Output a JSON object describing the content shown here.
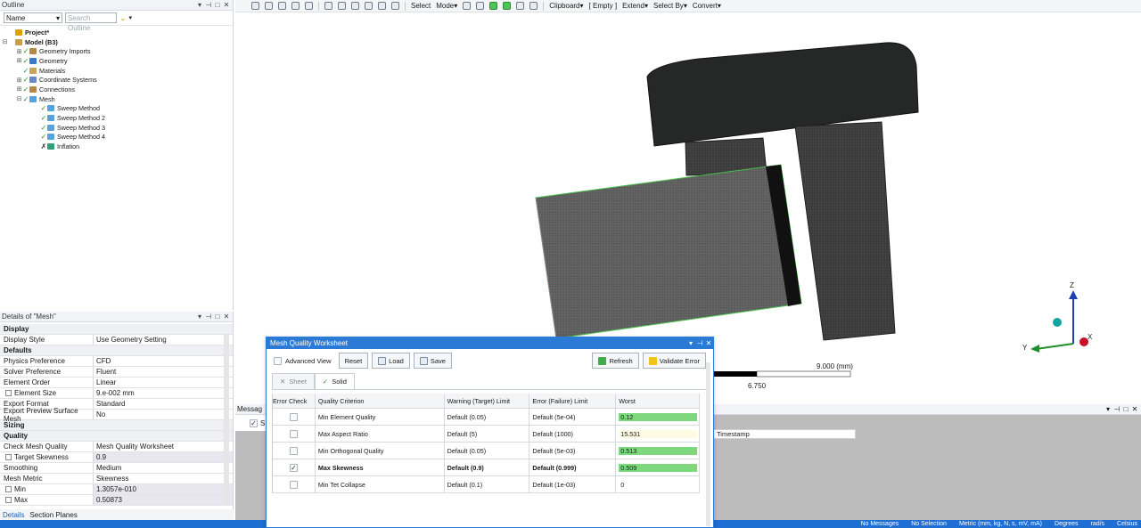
{
  "outline": {
    "title": "Outline",
    "controls": [
      "▾",
      "⊣",
      "□",
      "✕"
    ],
    "name_select": "Name",
    "search_placeholder": "Search Outline",
    "tree": [
      {
        "label": "Project*",
        "bold": true,
        "level": 0
      },
      {
        "label": "Model (B3)",
        "bold": true,
        "level": 1
      },
      {
        "label": "Geometry Imports",
        "level": 2
      },
      {
        "label": "Geometry",
        "level": 2
      },
      {
        "label": "Materials",
        "level": 2
      },
      {
        "label": "Coordinate Systems",
        "level": 2
      },
      {
        "label": "Connections",
        "level": 2
      },
      {
        "label": "Mesh",
        "level": 2
      },
      {
        "label": "Sweep Method",
        "level": 3
      },
      {
        "label": "Sweep Method 2",
        "level": 3
      },
      {
        "label": "Sweep Method 3",
        "level": 3
      },
      {
        "label": "Sweep Method 4",
        "level": 3
      },
      {
        "label": "Inflation",
        "level": 3
      }
    ]
  },
  "details": {
    "title": "Details of \"Mesh\"",
    "rows": [
      {
        "k": "Display",
        "v": "",
        "section": true
      },
      {
        "k": "Display Style",
        "v": "Use Geometry Setting"
      },
      {
        "k": "Defaults",
        "v": "",
        "section": true
      },
      {
        "k": "Physics Preference",
        "v": "CFD"
      },
      {
        "k": "Solver Preference",
        "v": "Fluent"
      },
      {
        "k": "Element Order",
        "v": "Linear"
      },
      {
        "k": "Element Size",
        "v": "9.e-002 mm",
        "sub": true
      },
      {
        "k": "Export Format",
        "v": "Standard"
      },
      {
        "k": "Export Preview Surface Mesh",
        "v": "No"
      },
      {
        "k": "Sizing",
        "v": "",
        "section": true
      },
      {
        "k": "Quality",
        "v": "",
        "section": true
      },
      {
        "k": "Check Mesh Quality",
        "v": "Mesh Quality Worksheet"
      },
      {
        "k": "Target Skewness",
        "v": "0.9",
        "sub": true,
        "hl": true
      },
      {
        "k": "Smoothing",
        "v": "Medium"
      },
      {
        "k": "Mesh Metric",
        "v": "Skewness"
      },
      {
        "k": "Min",
        "v": "1.3057e-010",
        "sub": true,
        "hl": true
      },
      {
        "k": "Max",
        "v": "0.50873",
        "sub": true,
        "hl": true
      }
    ],
    "tabs": [
      "Details",
      "Section Planes"
    ]
  },
  "toolbar": {
    "select": "Select",
    "mode": "Mode",
    "clipboard": "Clipboard",
    "empty": "[ Empty ]",
    "extend": "Extend",
    "select_by": "Select By",
    "convert": "Convert"
  },
  "viewport": {
    "scale_mid": "6.750",
    "scale_end": "9.000 (mm)",
    "axis_z": "Z",
    "axis_y": "Y",
    "axis_x": "X"
  },
  "messages": {
    "title": "Messag",
    "timestamp": "Timestamp",
    "s_label": "S"
  },
  "status": [
    "No Messages",
    "No Selection",
    "Metric (mm, kg, N, s, mV, mA)",
    "Degrees",
    "rad/s",
    "Celsius"
  ],
  "worksheet": {
    "title": "Mesh Quality Worksheet",
    "advanced_view": "Advanced View",
    "reset": "Reset",
    "load": "Load",
    "save": "Save",
    "refresh": "Refresh",
    "validate_error": "Validate Error",
    "tab_sheet": "Sheet",
    "tab_solid": "Solid",
    "headers": [
      "Error Check",
      "Quality Criterion",
      "Warning (Target) Limit",
      "Error (Failure) Limit",
      "Worst"
    ],
    "rows": [
      {
        "checked": false,
        "criterion": "Min Element Quality",
        "warning": "Default (0.05)",
        "error": "Default (5e-04)",
        "worst": "0.12",
        "bar": "green",
        "bold": false
      },
      {
        "checked": false,
        "criterion": "Max Aspect Ratio",
        "warning": "Default (5)",
        "error": "Default (1000)",
        "worst": "15.531",
        "bar": "yellow",
        "bold": false
      },
      {
        "checked": false,
        "criterion": "Min Orthogonal Quality",
        "warning": "Default (0.05)",
        "error": "Default (5e-03)",
        "worst": "0.513",
        "bar": "green",
        "bold": false
      },
      {
        "checked": true,
        "criterion": "Max Skewness",
        "warning": "Default (0.9)",
        "error": "Default (0.999)",
        "worst": "0.509",
        "bar": "green",
        "bold": true
      },
      {
        "checked": false,
        "criterion": "Min Tet Collapse",
        "warning": "Default (0.1)",
        "error": "Default (1e-03)",
        "worst": "0",
        "bar": "none",
        "bold": false
      }
    ]
  }
}
